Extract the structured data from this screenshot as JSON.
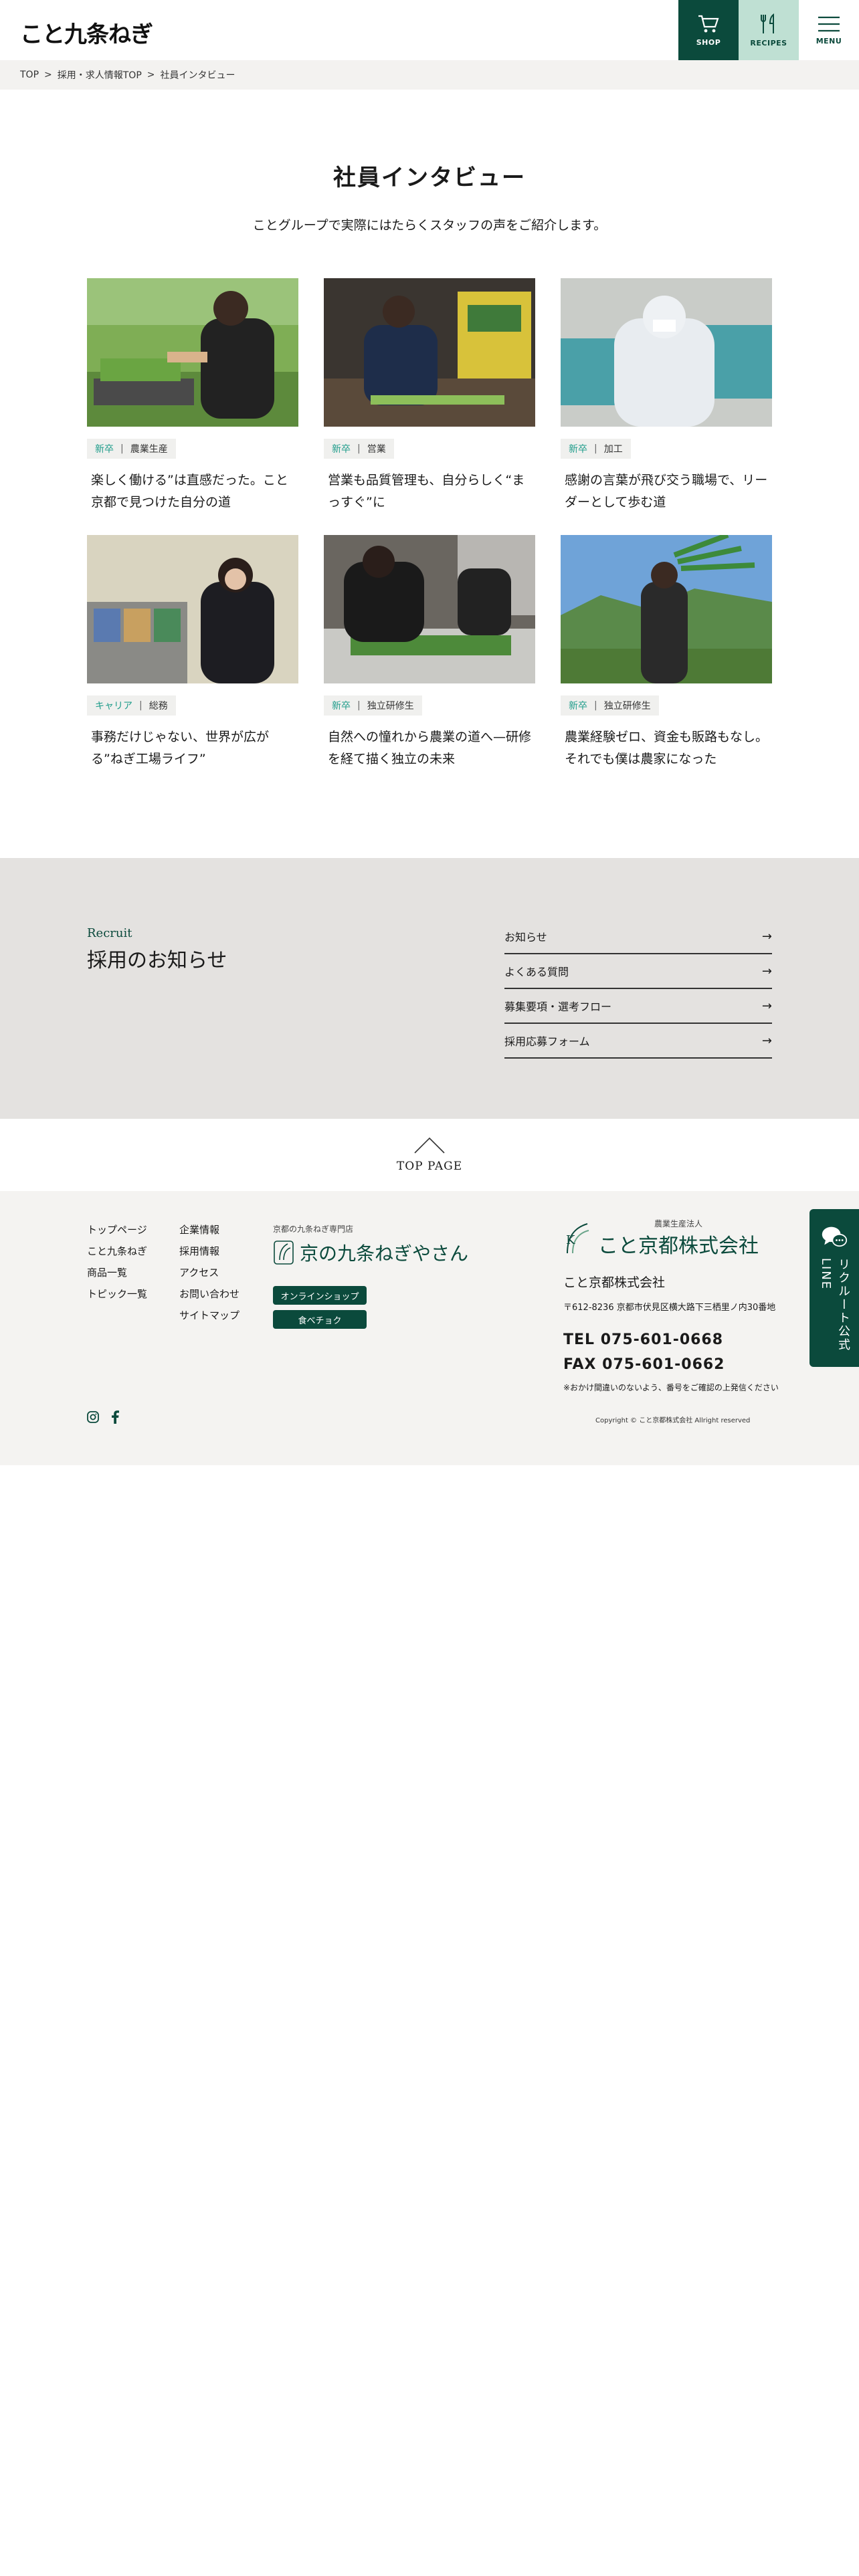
{
  "header": {
    "logo": "こと九条ねぎ",
    "shop_label": "SHOP",
    "recipes_label": "RECIPES",
    "menu_label": "MENU"
  },
  "breadcrumb": [
    "TOP",
    "採用・求人情報TOP",
    "社員インタビュー"
  ],
  "page": {
    "title": "社員インタビュー",
    "lead": "ことグループで実際にはたらくスタッフの声をご紹介します。"
  },
  "interviews": [
    {
      "tag_type": "新卒",
      "tag_role": "農業生産",
      "title": "楽しく働ける”は直感だった。こと京都で見つけた自分の道"
    },
    {
      "tag_type": "新卒",
      "tag_role": "営業",
      "title": "営業も品質管理も、自分らしく“まっすぐ”に"
    },
    {
      "tag_type": "新卒",
      "tag_role": "加工",
      "title": "感謝の言葉が飛び交う職場で、リーダーとして歩む道"
    },
    {
      "tag_type": "キャリア",
      "tag_role": "総務",
      "title": "事務だけじゃない、世界が広がる”ねぎ工場ライフ”"
    },
    {
      "tag_type": "新卒",
      "tag_role": "独立研修生",
      "title": "自然への憧れから農業の道へ—研修を経て描く独立の未来"
    },
    {
      "tag_type": "新卒",
      "tag_role": "独立研修生",
      "title": "農業経験ゼロ、資金も販路もなし。それでも僕は農家になった"
    }
  ],
  "news": {
    "label_en": "Recruit",
    "label_ja": "採用のお知らせ",
    "items": [
      "お知らせ",
      "よくある質問",
      "募集要項・選考フロー",
      "採用応募フォーム"
    ],
    "arrow": "→"
  },
  "toppage_label": "TOP PAGE",
  "footer": {
    "col1": [
      "トップページ",
      "こと九条ねぎ",
      "商品一覧",
      "トピック一覧"
    ],
    "col2": [
      "企業情報",
      "採用情報",
      "アクセス",
      "お問い合わせ",
      "サイトマップ"
    ],
    "kyo_small": "京都の九条ねぎ専門店",
    "kyo_logo": "京の九条ねぎやさん",
    "online_shop": "オンラインショップ",
    "tabechoku": "食べチョク",
    "corp_small": "農業生産法人",
    "corp_logo": "こと京都株式会社",
    "corp_name": "こと京都株式会社",
    "address": "〒612-8236 京都市伏見区横大路下三栖里ノ内30番地",
    "tel": "TEL 075-601-0668",
    "fax": "FAX 075-601-0662",
    "notice": "※おかけ間違いのないよう、番号をご確認の上発信ください",
    "copyright": "Copyright © こと京都株式会社 Allright reserved"
  },
  "line_float": {
    "label": "リクルート公式LINE"
  },
  "colors": {
    "brand_green": "#0b4a3c",
    "light_green": "#bfe0d3",
    "tag_teal": "#1e9c8a"
  }
}
